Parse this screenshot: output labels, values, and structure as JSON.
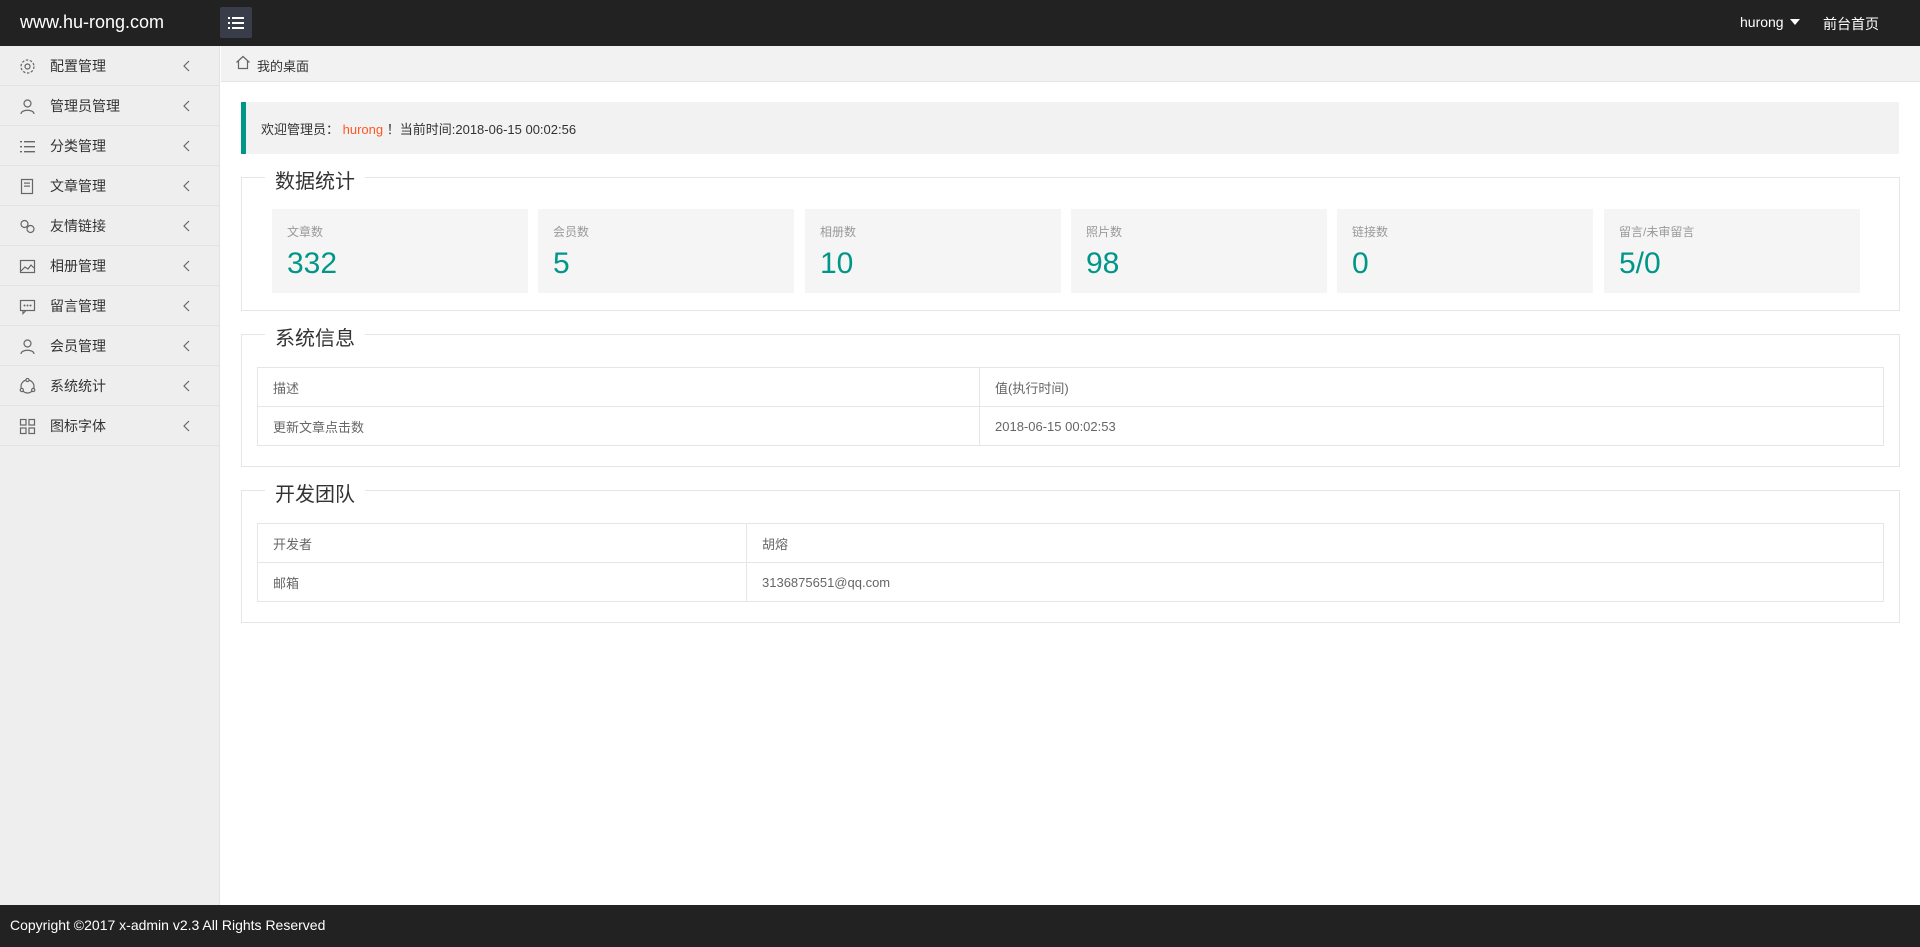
{
  "header": {
    "logo": "www.hu-rong.com",
    "user": "hurong",
    "front_link": "前台首页"
  },
  "sidebar": {
    "items": [
      {
        "label": "配置管理",
        "icon": "gear-icon"
      },
      {
        "label": "管理员管理",
        "icon": "admin-user-icon"
      },
      {
        "label": "分类管理",
        "icon": "list-icon"
      },
      {
        "label": "文章管理",
        "icon": "document-icon"
      },
      {
        "label": "友情链接",
        "icon": "link-icon"
      },
      {
        "label": "相册管理",
        "icon": "image-icon"
      },
      {
        "label": "留言管理",
        "icon": "message-icon"
      },
      {
        "label": "会员管理",
        "icon": "user-icon"
      },
      {
        "label": "系统统计",
        "icon": "stats-icon"
      },
      {
        "label": "图标字体",
        "icon": "grid-icon"
      }
    ]
  },
  "breadcrumb": "我的桌面",
  "welcome": {
    "prefix": "欢迎管理员：",
    "username": "hurong",
    "suffix": "！当前时间:2018-06-15 00:02:56"
  },
  "stats": {
    "title": "数据统计",
    "cards": [
      {
        "label": "文章数",
        "value": "332"
      },
      {
        "label": "会员数",
        "value": "5"
      },
      {
        "label": "相册数",
        "value": "10"
      },
      {
        "label": "照片数",
        "value": "98"
      },
      {
        "label": "链接数",
        "value": "0"
      },
      {
        "label": "留言/未审留言",
        "value": "5/0"
      }
    ]
  },
  "system_info": {
    "title": "系统信息",
    "rows": [
      [
        "描述",
        "值(执行时间)"
      ],
      [
        "更新文章点击数",
        "2018-06-15 00:02:53"
      ]
    ]
  },
  "dev_team": {
    "title": "开发团队",
    "rows": [
      [
        "开发者",
        "胡熔"
      ],
      [
        "邮箱",
        "3136875651@qq.com"
      ]
    ]
  },
  "footer": "Copyright ©2017 x-admin v2.3 All Rights Reserved",
  "colors": {
    "accent": "#009688",
    "username_highlight": "#FF5722",
    "header_bg": "#222222",
    "sidebar_bg": "#EEEEEE"
  }
}
